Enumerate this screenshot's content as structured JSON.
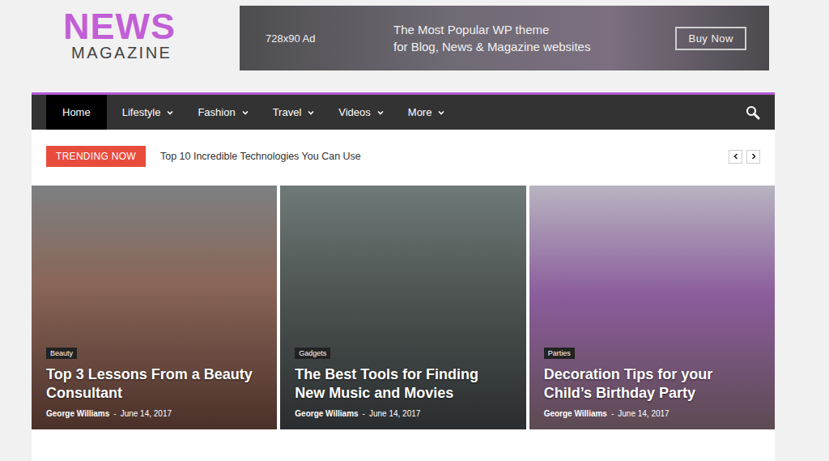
{
  "logo": {
    "title": "NEWS",
    "subtitle": "MAGAZINE"
  },
  "ad": {
    "size": "728x90 Ad",
    "line1": "The Most Popular WP theme",
    "line2": "for Blog, News & Magazine websites",
    "button": "Buy Now"
  },
  "nav": {
    "items": [
      {
        "label": "Home",
        "selected": true,
        "dropdown": false
      },
      {
        "label": "Lifestyle",
        "selected": false,
        "dropdown": true
      },
      {
        "label": "Fashion",
        "selected": false,
        "dropdown": true
      },
      {
        "label": "Travel",
        "selected": false,
        "dropdown": true
      },
      {
        "label": "Videos",
        "selected": false,
        "dropdown": true
      },
      {
        "label": "More",
        "selected": false,
        "dropdown": true
      }
    ]
  },
  "trending": {
    "badge": "TRENDING NOW",
    "headline": "Top 10 Incredible Technologies You Can Use"
  },
  "featured": {
    "separator": "-",
    "cards": [
      {
        "category": "Beauty",
        "title": "Top 3 Lessons From a Beauty Consultant",
        "author": "George Williams",
        "date": "June 14, 2017"
      },
      {
        "category": "Gadgets",
        "title": "The Best Tools for Finding New Music and Movies",
        "author": "George Williams",
        "date": "June 14, 2017"
      },
      {
        "category": "Parties",
        "title": "Decoration Tips for your Child’s Birthday Party",
        "author": "George Williams",
        "date": "June 14, 2017"
      }
    ]
  }
}
